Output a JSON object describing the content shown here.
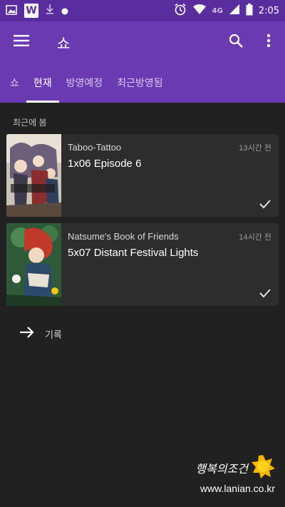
{
  "status_bar": {
    "clock": "2:05",
    "network": "4G",
    "icons": [
      "image-icon",
      "w-app-icon",
      "download-icon",
      "dot-icon",
      "alarm-icon",
      "wifi-icon",
      "signal-icon",
      "battery-icon"
    ],
    "w_label": "W"
  },
  "app_bar": {
    "title": "쇼",
    "icons": [
      "menu-icon",
      "search-icon",
      "more-vert-icon"
    ]
  },
  "tabs": [
    {
      "label": "쇼",
      "active": false
    },
    {
      "label": "현재",
      "active": true
    },
    {
      "label": "방영예정",
      "active": false
    },
    {
      "label": "최근방영됨",
      "active": false
    }
  ],
  "section": {
    "title": "최근에 봄"
  },
  "recent": [
    {
      "show": "Taboo-Tattoo",
      "episode": "1x06 Episode 6",
      "time": "13시간 전",
      "watched": true
    },
    {
      "show": "Natsume's Book of Friends",
      "episode": "5x07 Distant Festival Lights",
      "time": "14시간 전",
      "watched": true
    }
  ],
  "history": {
    "label": "기록",
    "icon": "arrow-right-icon"
  },
  "watermark": {
    "title": "행복의조건",
    "url": "www.lanian.co.kr"
  },
  "colors": {
    "status_bar": "#5a2d9e",
    "primary": "#6a3ab2",
    "background": "#212121",
    "card": "#2d2d2d"
  }
}
